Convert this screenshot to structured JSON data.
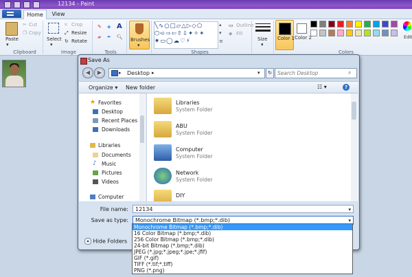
{
  "window": {
    "title": "12134 - Paint"
  },
  "tabs": {
    "home": "Home",
    "view": "View"
  },
  "ribbon": {
    "clipboard": {
      "label": "Clipboard",
      "paste": "Paste",
      "cut": "Cut",
      "copy": "Copy"
    },
    "image": {
      "label": "Image",
      "select": "Select",
      "crop": "Crop",
      "resize": "Resize",
      "rotate": "Rotate"
    },
    "tools": {
      "label": "Tools"
    },
    "brushes": "Brushes",
    "shapes": {
      "label": "Shapes",
      "outline": "Outline",
      "fill": "Fill"
    },
    "size": "Size",
    "color1": "Color 1",
    "color2": "Color 2",
    "colors_label": "Colors",
    "edit_colors": "Edit colo",
    "colors": {
      "row1": [
        "#000000",
        "#7f7f7f",
        "#880015",
        "#ed1c24",
        "#ff7f27",
        "#fff200",
        "#22b14c",
        "#00a2e8",
        "#3f48cc",
        "#a349a4"
      ],
      "row2": [
        "#ffffff",
        "#c3c3c3",
        "#b97a57",
        "#ffaec9",
        "#ffc90e",
        "#efe4b0",
        "#b5e61d",
        "#99d9ea",
        "#7092be",
        "#c8bfe7"
      ]
    }
  },
  "dialog": {
    "title": "Save As",
    "address": "Desktop",
    "search_placeholder": "Search Desktop",
    "organize": "Organize",
    "new_folder": "New folder",
    "nav": {
      "favorites": "Favorites",
      "desktop": "Desktop",
      "recent_places": "Recent Places",
      "downloads": "Downloads",
      "libraries": "Libraries",
      "documents": "Documents",
      "music": "Music",
      "pictures": "Pictures",
      "videos": "Videos",
      "computer": "Computer"
    },
    "files": [
      {
        "name": "Libraries",
        "type": "System Folder"
      },
      {
        "name": "ABU",
        "type": "System Folder"
      },
      {
        "name": "Computer",
        "type": "System Folder"
      },
      {
        "name": "Network",
        "type": "System Folder"
      },
      {
        "name": "DIY",
        "type": ""
      }
    ],
    "file_name_label": "File name:",
    "file_name_value": "12134",
    "save_as_type_label": "Save as type:",
    "save_as_type_value": "Monochrome Bitmap (*.bmp;*.dib)",
    "hide_folders": "Hide Folders",
    "type_options": [
      "Monochrome Bitmap (*.bmp;*.dib)",
      "16 Color Bitmap (*.bmp;*.dib)",
      "256 Color Bitmap (*.bmp;*.dib)",
      "24-bit Bitmap (*.bmp;*.dib)",
      "JPEG (*.jpg;*.jpeg;*.jpe;*.jfif)",
      "GIF (*.gif)",
      "TIFF (*.tif;*.tiff)",
      "PNG (*.png)"
    ]
  }
}
